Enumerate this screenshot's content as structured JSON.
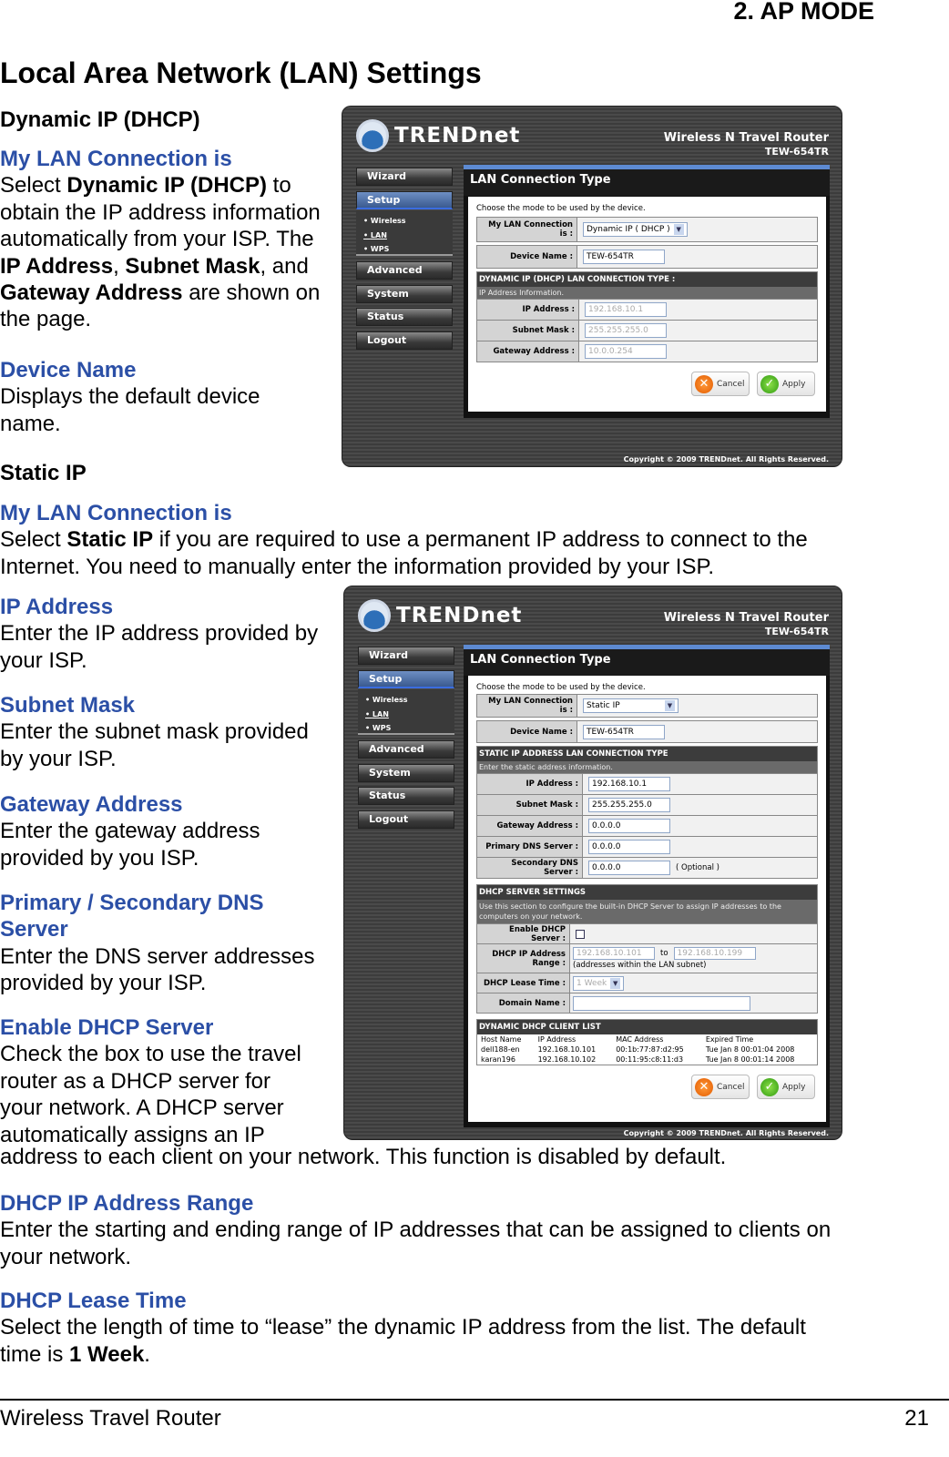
{
  "chapter": "2.  AP MODE",
  "title": "Local Area Network (LAN) Settings",
  "dynamic": {
    "heading": "Dynamic IP (DHCP)",
    "lan_heading": "My LAN Connection is",
    "lan_text": [
      "Select ",
      "Dynamic IP (DHCP)",
      " to obtain the IP address information automatically from your ISP. The ",
      "IP Address",
      ", ",
      "Subnet Mask",
      ", and ",
      "Gateway Address",
      " are shown on the page."
    ],
    "device_heading": "Device Name",
    "device_text": "Displays the default device name."
  },
  "static": {
    "heading": "Static IP",
    "lan_heading": "My LAN Connection is",
    "lan_text": [
      "Select ",
      "Static IP",
      " if you are required to use a permanent IP address to connect to the Internet. You need to manually enter the information provided by your ISP."
    ],
    "ip_heading": "IP Address",
    "ip_text": "Enter the IP address provided by your ISP.",
    "mask_heading": "Subnet Mask",
    "mask_text": "Enter the subnet mask provided by your ISP.",
    "gw_heading": "Gateway Address",
    "gw_text": "Enter the gateway address provided by you ISP.",
    "dns_heading": "Primary / Secondary DNS Server",
    "dns_text": "Enter the DNS server addresses provided by your ISP.",
    "dhcp_heading": "Enable DHCP Server",
    "dhcp_text_1": "Check the box to use the travel router as a DHCP server for your network. A DHCP server automatically assigns an IP",
    "dhcp_text_2": "address to each client on your network. This function is disabled by default.",
    "range_heading": "DHCP IP Address Range",
    "range_text": "Enter the starting and ending range of IP addresses that can be assigned to clients on your network.",
    "lease_heading": "DHCP Lease Time",
    "lease_text": [
      "Select the length of time to “lease” the dynamic IP address from the list. The default time is ",
      "1 Week",
      "."
    ]
  },
  "router": {
    "brand": "TRENDnet",
    "product": "Wireless N Travel Router",
    "model": "TEW-654TR",
    "nav": [
      "Wizard",
      "Setup",
      "Advanced",
      "System",
      "Status",
      "Logout"
    ],
    "subnav": [
      "Wireless",
      "LAN",
      "WPS"
    ],
    "panel_title": "LAN Connection Type",
    "intro": "Choose the mode to be used by the device.",
    "conn_label": "My LAN Connection is :",
    "device_label": "Device Name :",
    "device_value": "TEW-654TR",
    "ip_label": "IP Address :",
    "mask_label": "Subnet Mask :",
    "gw_label": "Gateway Address :",
    "cancel": "Cancel",
    "apply": "Apply",
    "copyright": "Copyright © 2009 TRENDnet. All Rights Reserved."
  },
  "shot1": {
    "conn_value": "Dynamic IP ( DHCP )",
    "section": "DYNAMIC IP (DHCP) LAN CONNECTION TYPE :",
    "section_sub": "IP Address Information.",
    "ip": "192.168.10.1",
    "mask": "255.255.255.0",
    "gw": "10.0.0.254"
  },
  "shot2": {
    "conn_value": "Static IP",
    "section": "STATIC IP ADDRESS LAN CONNECTION TYPE",
    "section_sub": "Enter the static address information.",
    "ip": "192.168.10.1",
    "mask": "255.255.255.0",
    "gw": "0.0.0.0",
    "pdns_label": "Primary DNS Server :",
    "pdns": "0.0.0.0",
    "sdns_label": "Secondary DNS Server :",
    "sdns": "0.0.0.0",
    "optional": "( Optional )",
    "dhcp_section": "DHCP SERVER SETTINGS",
    "dhcp_desc": "Use this section to configure the built-in DHCP Server to assign IP addresses to the computers on your network.",
    "enable_label": "Enable DHCP Server :",
    "enable_checked": false,
    "range_label": "DHCP IP Address Range :",
    "range_start": "192.168.10.101",
    "range_to": "to",
    "range_end": "192.168.10.199",
    "range_note": "(addresses within the LAN subnet)",
    "lease_label": "DHCP Lease Time :",
    "lease_value": "1 Week",
    "domain_label": "Domain Name :",
    "domain_value": "",
    "client_section": "DYNAMIC DHCP CLIENT LIST",
    "client_headers": [
      "Host Name",
      "IP Address",
      "MAC Address",
      "Expired Time"
    ],
    "clients": [
      [
        "dell188-en",
        "192.168.10.101",
        "00:1b:77:87:d2:95",
        "Tue Jan 8 00:01:04 2008"
      ],
      [
        "karan196",
        "192.168.10.102",
        "00:11:95:c8:11:d3",
        "Tue Jan 8 00:01:14 2008"
      ]
    ]
  }
}
